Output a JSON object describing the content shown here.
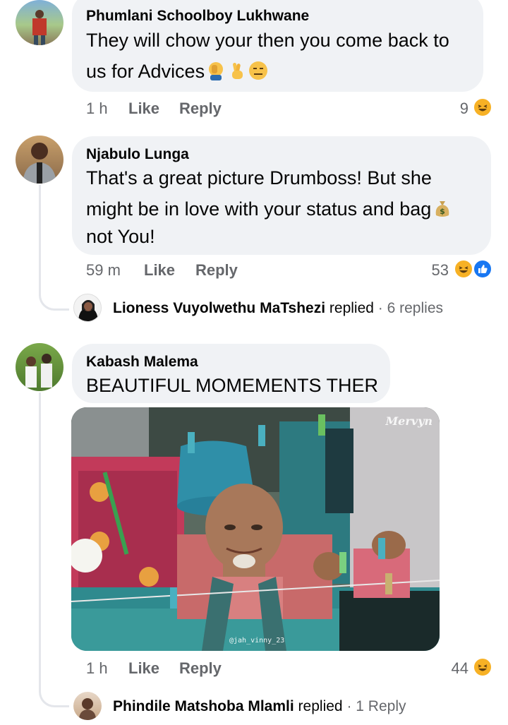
{
  "comments": [
    {
      "author": "Phumlani Schoolboy Lukhwane",
      "text_line1": "They will chow your then you come back to",
      "text_line2": "us for Advices",
      "emojis": [
        "facepalm-emoji",
        "crossed-fingers-emoji",
        "expressionless-emoji"
      ],
      "time": "1 h",
      "like": "Like",
      "reply": "Reply",
      "reaction_count": "9",
      "reactions": [
        "laugh"
      ]
    },
    {
      "author": "Njabulo Lunga",
      "text_line1": "That's a great picture Drumboss! But she",
      "text_line2": "might be in love with your status and bag",
      "text_line3": "not You!",
      "emojis": [
        "money-bag-emoji"
      ],
      "time": "59 m",
      "like": "Like",
      "reply": "Reply",
      "reaction_count": "53",
      "reactions": [
        "laugh",
        "like"
      ],
      "replies_summary": {
        "name": "Lioness Vuyolwethu MaTshezi",
        "action": "replied",
        "sep": "·",
        "count": "6 replies"
      }
    },
    {
      "author": "Kabash Malema",
      "text_line1": "BEAUTIFUL MOMEMENTS THER",
      "image": {
        "watermark": "Mervyn",
        "credit": "@jah_vinny_23"
      },
      "time": "1 h",
      "like": "Like",
      "reply": "Reply",
      "reaction_count": "44",
      "reactions": [
        "laugh"
      ],
      "replies_summary": {
        "name": "Phindile Matshoba Mlamli",
        "action": "replied",
        "sep": "·",
        "count": "1 Reply"
      }
    }
  ],
  "colors": {
    "bubble": "#f0f2f5",
    "muted": "#65676b",
    "like_blue": "#1877f2",
    "laugh_yellow": "#f7b125"
  }
}
